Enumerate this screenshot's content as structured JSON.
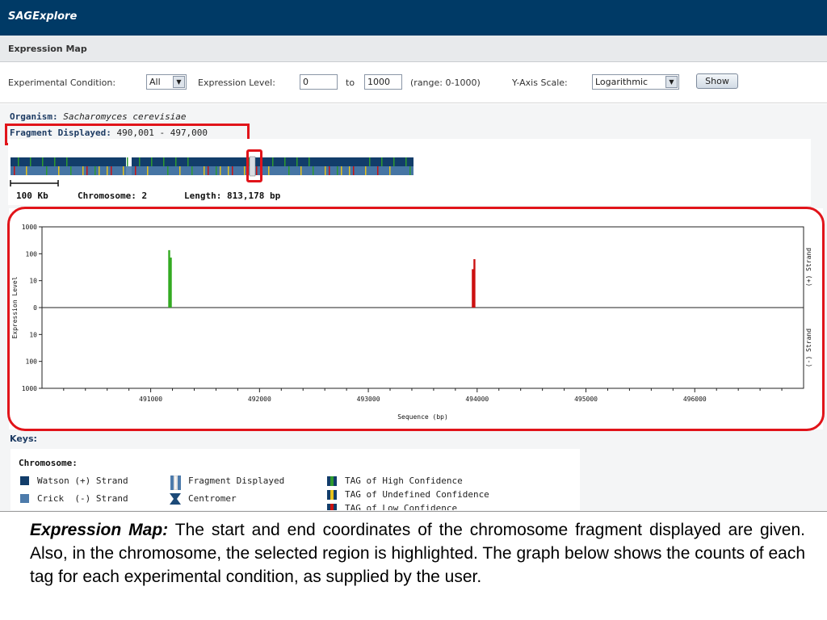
{
  "app": {
    "title": "SAGExplore"
  },
  "section": {
    "title": "Expression Map"
  },
  "controls": {
    "condition_label": "Experimental Condition:",
    "condition_value": "All",
    "level_label": "Expression Level:",
    "level_from": "0",
    "to_label": "to",
    "level_to": "1000",
    "range_text": "(range: 0-1000)",
    "yscale_label": "Y-Axis Scale:",
    "yscale_value": "Logarithmic",
    "show_label": "Show"
  },
  "info": {
    "organism_label": "Organism:",
    "organism_value": "Sacharomyces cerevisiae",
    "fragment_label": "Fragment Displayed:",
    "fragment_value": "490,001 - 497,000",
    "scale_label": "100 Kb",
    "chromosome_text": "Chromosome: 2",
    "length_text": "Length: 813,178 bp"
  },
  "chart_data": {
    "type": "bar",
    "title": "",
    "xlabel": "Sequence (bp)",
    "ylabel": "Expression Level",
    "xlim": [
      490001,
      497000
    ],
    "x_ticks": [
      491000,
      492000,
      493000,
      494000,
      495000,
      496000
    ],
    "y_tick_labels_top": [
      "1000",
      "100",
      "10",
      "0"
    ],
    "y_tick_labels_bottom": [
      "10",
      "100",
      "1000"
    ],
    "y_scale": "log",
    "right_labels": [
      "(+) Strand",
      "(-) Strand"
    ],
    "series": [
      {
        "strand": "+",
        "color": "#33aa22",
        "points": [
          {
            "x": 491170,
            "y": 70
          },
          {
            "x": 491185,
            "y": 30
          }
        ]
      },
      {
        "strand": "+",
        "color": "#cc1111",
        "points": [
          {
            "x": 493960,
            "y": 8
          },
          {
            "x": 493975,
            "y": 25
          }
        ]
      }
    ],
    "grid": false
  },
  "keys": {
    "title": "Keys:",
    "chromosome_heading": "Chromosome:",
    "items": [
      {
        "label": "Watson (+) Strand",
        "icon": "watson-swatch-icon",
        "color": "#123d6a"
      },
      {
        "label": "Crick  (-) Strand",
        "icon": "crick-swatch-icon",
        "color": "#4d7bab"
      },
      {
        "label": "Fragment Displayed",
        "icon": "fragment-displayed-icon"
      },
      {
        "label": "Centromer",
        "icon": "centromer-icon"
      },
      {
        "label": "TAG of High Confidence",
        "icon": "high-confidence-icon",
        "color": "#2e9a2e"
      },
      {
        "label": "TAG of Undefined Confidence",
        "icon": "undefined-confidence-icon",
        "color": "#e6c21b"
      },
      {
        "label": "TAG of Low Confidence",
        "icon": "low-confidence-icon",
        "color": "#cc1111"
      }
    ]
  },
  "caption": {
    "lead": "Expression Map:",
    "body": " The start and end coordinates of the chromosome fragment displayed are given. Also, in the chromosome, the selected region is highlighted. The graph below shows the counts of each tag for each experimental condition, as supplied by the user."
  }
}
